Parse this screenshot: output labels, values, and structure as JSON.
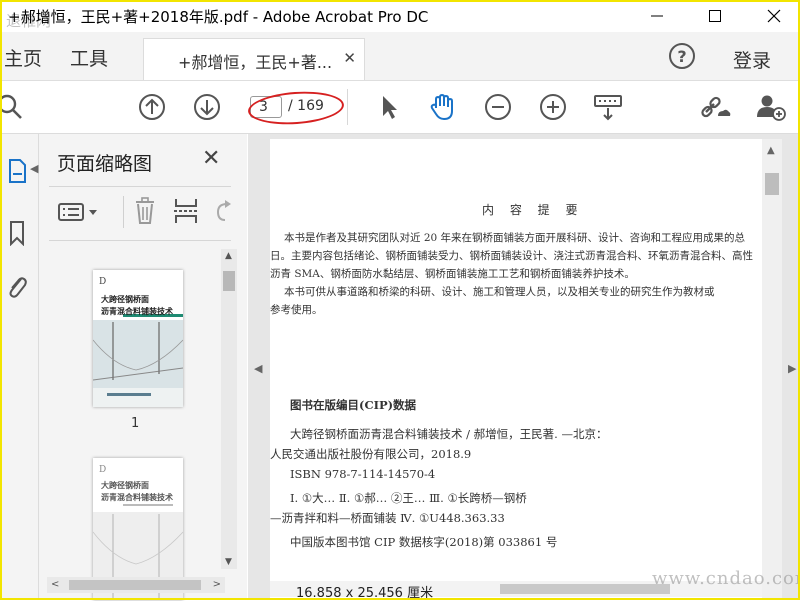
{
  "window": {
    "title": "+郝增恒，王民+著+2018年版.pdf - Adobe Acrobat Pro DC",
    "watermark_top": "退稚网"
  },
  "nav": {
    "home": "主页",
    "tools": "工具",
    "doc_tab_label": "+郝增恒，王民+著...",
    "login": "登录"
  },
  "toolbar": {
    "current_page": "3",
    "total_pages": "/ 169"
  },
  "thumbnail_panel": {
    "title": "页面缩略图",
    "thumbs": [
      {
        "title_line1": "大跨径钢桥面",
        "title_line2": "沥青混合料铺装技术",
        "page_label": "1"
      },
      {
        "title_line1": "大跨径钢桥面",
        "title_line2": "沥青混合料铺装技术"
      }
    ]
  },
  "document": {
    "heading": "内 容 提 要",
    "summary_lines": [
      "本书是作者及其研究团队对近 20 年来在钢桥面铺装方面开展科研、设计、咨询和工程应用成果的总",
      "日。主要内容包括绪论、钢桥面铺装受力、钢桥面铺装设计、浇注式沥青混合料、环氧沥青混合料、高性",
      "沥青 SMA、钢桥面防水黏结层、钢桥面铺装施工工艺和钢桥面铺装养护技术。",
      "本书可供从事道路和桥梁的科研、设计、施工和管理人员，以及相关专业的研究生作为教材或",
      "参考使用。"
    ],
    "cip_heading": "图书在版编目(CIP)数据",
    "cip_lines": [
      "大跨径钢桥面沥青混合料铺装技术 / 郝增恒，王民著. —北京：",
      "人民交通出版社股份有限公司，2018.9",
      "ISBN 978-7-114-14570-4",
      "Ⅰ. ①大…   Ⅱ. ①郝…   ②王…   Ⅲ. ①长跨桥—钢桥",
      "—沥青拌和料—桥面铺装  Ⅳ. ①U448.363.33",
      "中国版本图书馆 CIP 数据核字(2018)第 033861 号"
    ],
    "page_size": "16.858 x 25.456 厘米",
    "watermark": "www.cndao.com"
  },
  "colors": {
    "annotation_ellipse": "#d62020",
    "frame": "#f2e500",
    "icon": "#555555",
    "hand_tool": "#1a73c8"
  }
}
